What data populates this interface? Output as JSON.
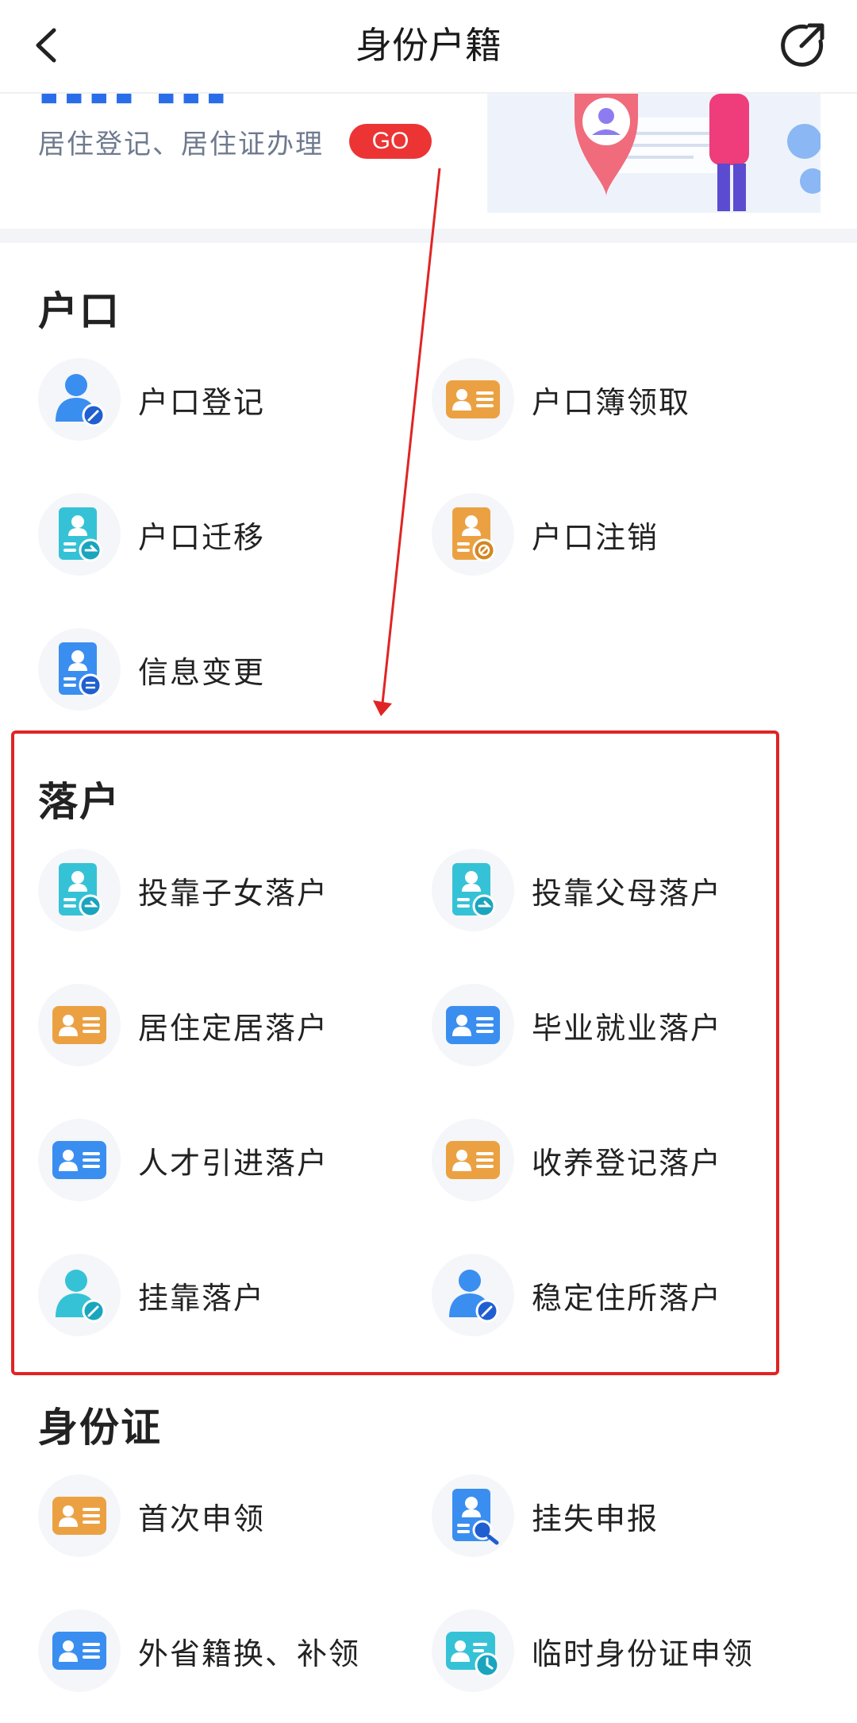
{
  "header": {
    "title": "身份户籍",
    "back_icon": "chevron-left-icon",
    "share_icon": "share-icon"
  },
  "banner": {
    "subtitle": "居住登记、居住证办理",
    "go_label": "GO"
  },
  "sections": {
    "hukou": {
      "title": "户口",
      "items": [
        {
          "label": "户口登记",
          "icon": "person-edit-icon"
        },
        {
          "label": "户口簿领取",
          "icon": "id-card-icon"
        },
        {
          "label": "户口迁移",
          "icon": "doc-transfer-icon"
        },
        {
          "label": "户口注销",
          "icon": "doc-cancel-icon"
        },
        {
          "label": "信息变更",
          "icon": "doc-exchange-icon"
        }
      ]
    },
    "luohu": {
      "title": "落户",
      "items": [
        {
          "label": "投靠子女落户",
          "icon": "doc-transfer-icon"
        },
        {
          "label": "投靠父母落户",
          "icon": "doc-transfer-icon"
        },
        {
          "label": "居住定居落户",
          "icon": "id-card-icon"
        },
        {
          "label": "毕业就业落户",
          "icon": "id-card-icon"
        },
        {
          "label": "人才引进落户",
          "icon": "id-card-icon"
        },
        {
          "label": "收养登记落户",
          "icon": "id-card-icon"
        },
        {
          "label": "挂靠落户",
          "icon": "person-edit-icon"
        },
        {
          "label": "稳定住所落户",
          "icon": "person-edit-icon"
        }
      ]
    },
    "idcard": {
      "title": "身份证",
      "items": [
        {
          "label": "首次申领",
          "icon": "id-card-icon"
        },
        {
          "label": "挂失申报",
          "icon": "doc-search-icon"
        },
        {
          "label": "外省籍换、补领",
          "icon": "id-card-icon"
        },
        {
          "label": "临时身份证申领",
          "icon": "id-card-clock-icon"
        }
      ]
    }
  },
  "colors": {
    "blue": "#3a8ef0",
    "orange": "#eba142",
    "teal": "#36c2d6",
    "go_red": "#ec3434",
    "annotation_red": "#e02424"
  }
}
